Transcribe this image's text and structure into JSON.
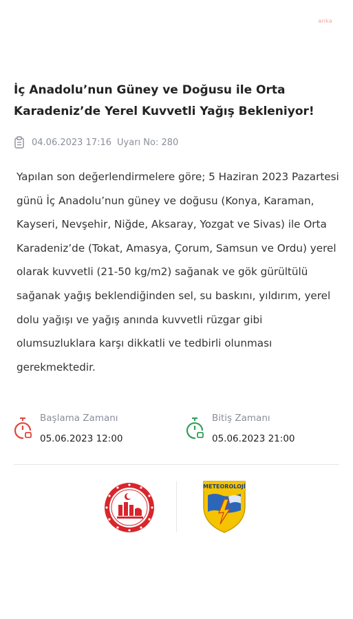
{
  "watermark": "anka",
  "title": "İç Anadolu’nun Güney ve Doğusu ile Orta Karadeniz’de Yerel Kuvvetli Yağış Bekleniyor!",
  "meta": {
    "icon": "clipboard-icon",
    "datetime": "04.06.2023 17:16",
    "warning_no": "Uyarı No: 280"
  },
  "body": "Yapılan son değerlendirmelere göre; 5 Haziran 2023 Pazartesi günü İç Anadolu’nun güney ve doğusu (Konya, Karaman, Kayseri, Nevşehir, Niğde, Aksaray, Yozgat ve Sivas) ile Orta Karadeniz’de (Tokat, Amasya, Çorum, Samsun ve Ordu) yerel olarak kuvvetli (21-50 kg/m2) sağanak ve gök gürültülü sağanak yağış beklendiğinden sel, su baskını, yıldırım, yerel dolu yağışı ve yağış anında kuvvetli rüzgar gibi olumsuzluklara karşı dikkatli ve tedbirli olunması gerekmektedir.",
  "start": {
    "label": "Başlama Zamanı",
    "value": "05.06.2023 12:00",
    "icon": "stopwatch-icon",
    "color": "#e0453a"
  },
  "end": {
    "label": "Bitiş Zamanı",
    "value": "05.06.2023 21:00",
    "icon": "stopwatch-icon",
    "color": "#2f9e58"
  },
  "logos": {
    "left": "ministry-seal-logo",
    "right": "meteoroloji-logo",
    "right_text": "METEOROLOJİ",
    "seal_color": "#d7262c",
    "meteo_yellow": "#f5c400",
    "meteo_blue": "#2b66b8"
  }
}
